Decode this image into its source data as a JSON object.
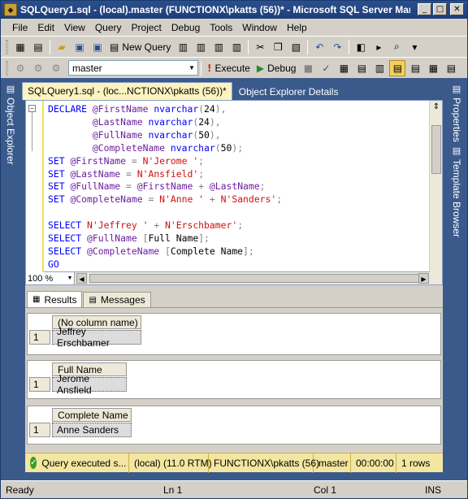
{
  "window": {
    "title": "SQLQuery1.sql - (local).master (FUNCTIONX\\pkatts (56))* - Microsoft SQL Server Man...",
    "minimize": "_",
    "maximize": "□",
    "close": "✕"
  },
  "menu": [
    "File",
    "Edit",
    "View",
    "Query",
    "Project",
    "Debug",
    "Tools",
    "Window",
    "Help"
  ],
  "toolbar": {
    "new_query": "New Query",
    "database": "master",
    "execute": "Execute",
    "debug": "Debug"
  },
  "side_tabs": {
    "left": "Object Explorer",
    "right_properties": "Properties",
    "right_template": "Template Browser"
  },
  "doc_tabs": {
    "active": "SQLQuery1.sql - (loc...NCTIONX\\pkatts (56))*",
    "inactive": "Object Explorer Details"
  },
  "editor": {
    "zoom": "100 %",
    "lines": [
      "DECLARE @FirstName nvarchar(24),",
      "        @LastName nvarchar(24),",
      "        @FullName nvarchar(50),",
      "        @CompleteName nvarchar(50);",
      "SET @FirstName = N'Jerome ';",
      "SET @LastName = N'Ansfield';",
      "SET @FullName = @FirstName + @LastName;",
      "SET @CompleteName = N'Anne ' + N'Sanders';",
      "",
      "SELECT N'Jeffrey ' + N'Erschbamer';",
      "SELECT @FullName [Full Name];",
      "SELECT @CompleteName [Complete Name];",
      "GO"
    ]
  },
  "results": {
    "tab_results": "Results",
    "tab_messages": "Messages",
    "grids": [
      {
        "header": "(No column name)",
        "row_number": "1",
        "value": "Jeffrey Erschbamer"
      },
      {
        "header": "Full Name",
        "row_number": "1",
        "value": "Jerome Ansfield"
      },
      {
        "header": "Complete Name",
        "row_number": "1",
        "value": "Anne Sanders"
      }
    ]
  },
  "query_status": {
    "message": "Query executed s...",
    "server": "(local) (11.0 RTM)",
    "user": "FUNCTIONX\\pkatts (56)",
    "database": "master",
    "time": "00:00:00",
    "rows": "1 rows"
  },
  "status_bar": {
    "state": "Ready",
    "line": "Ln 1",
    "col": "Col 1",
    "mode": "INS"
  }
}
